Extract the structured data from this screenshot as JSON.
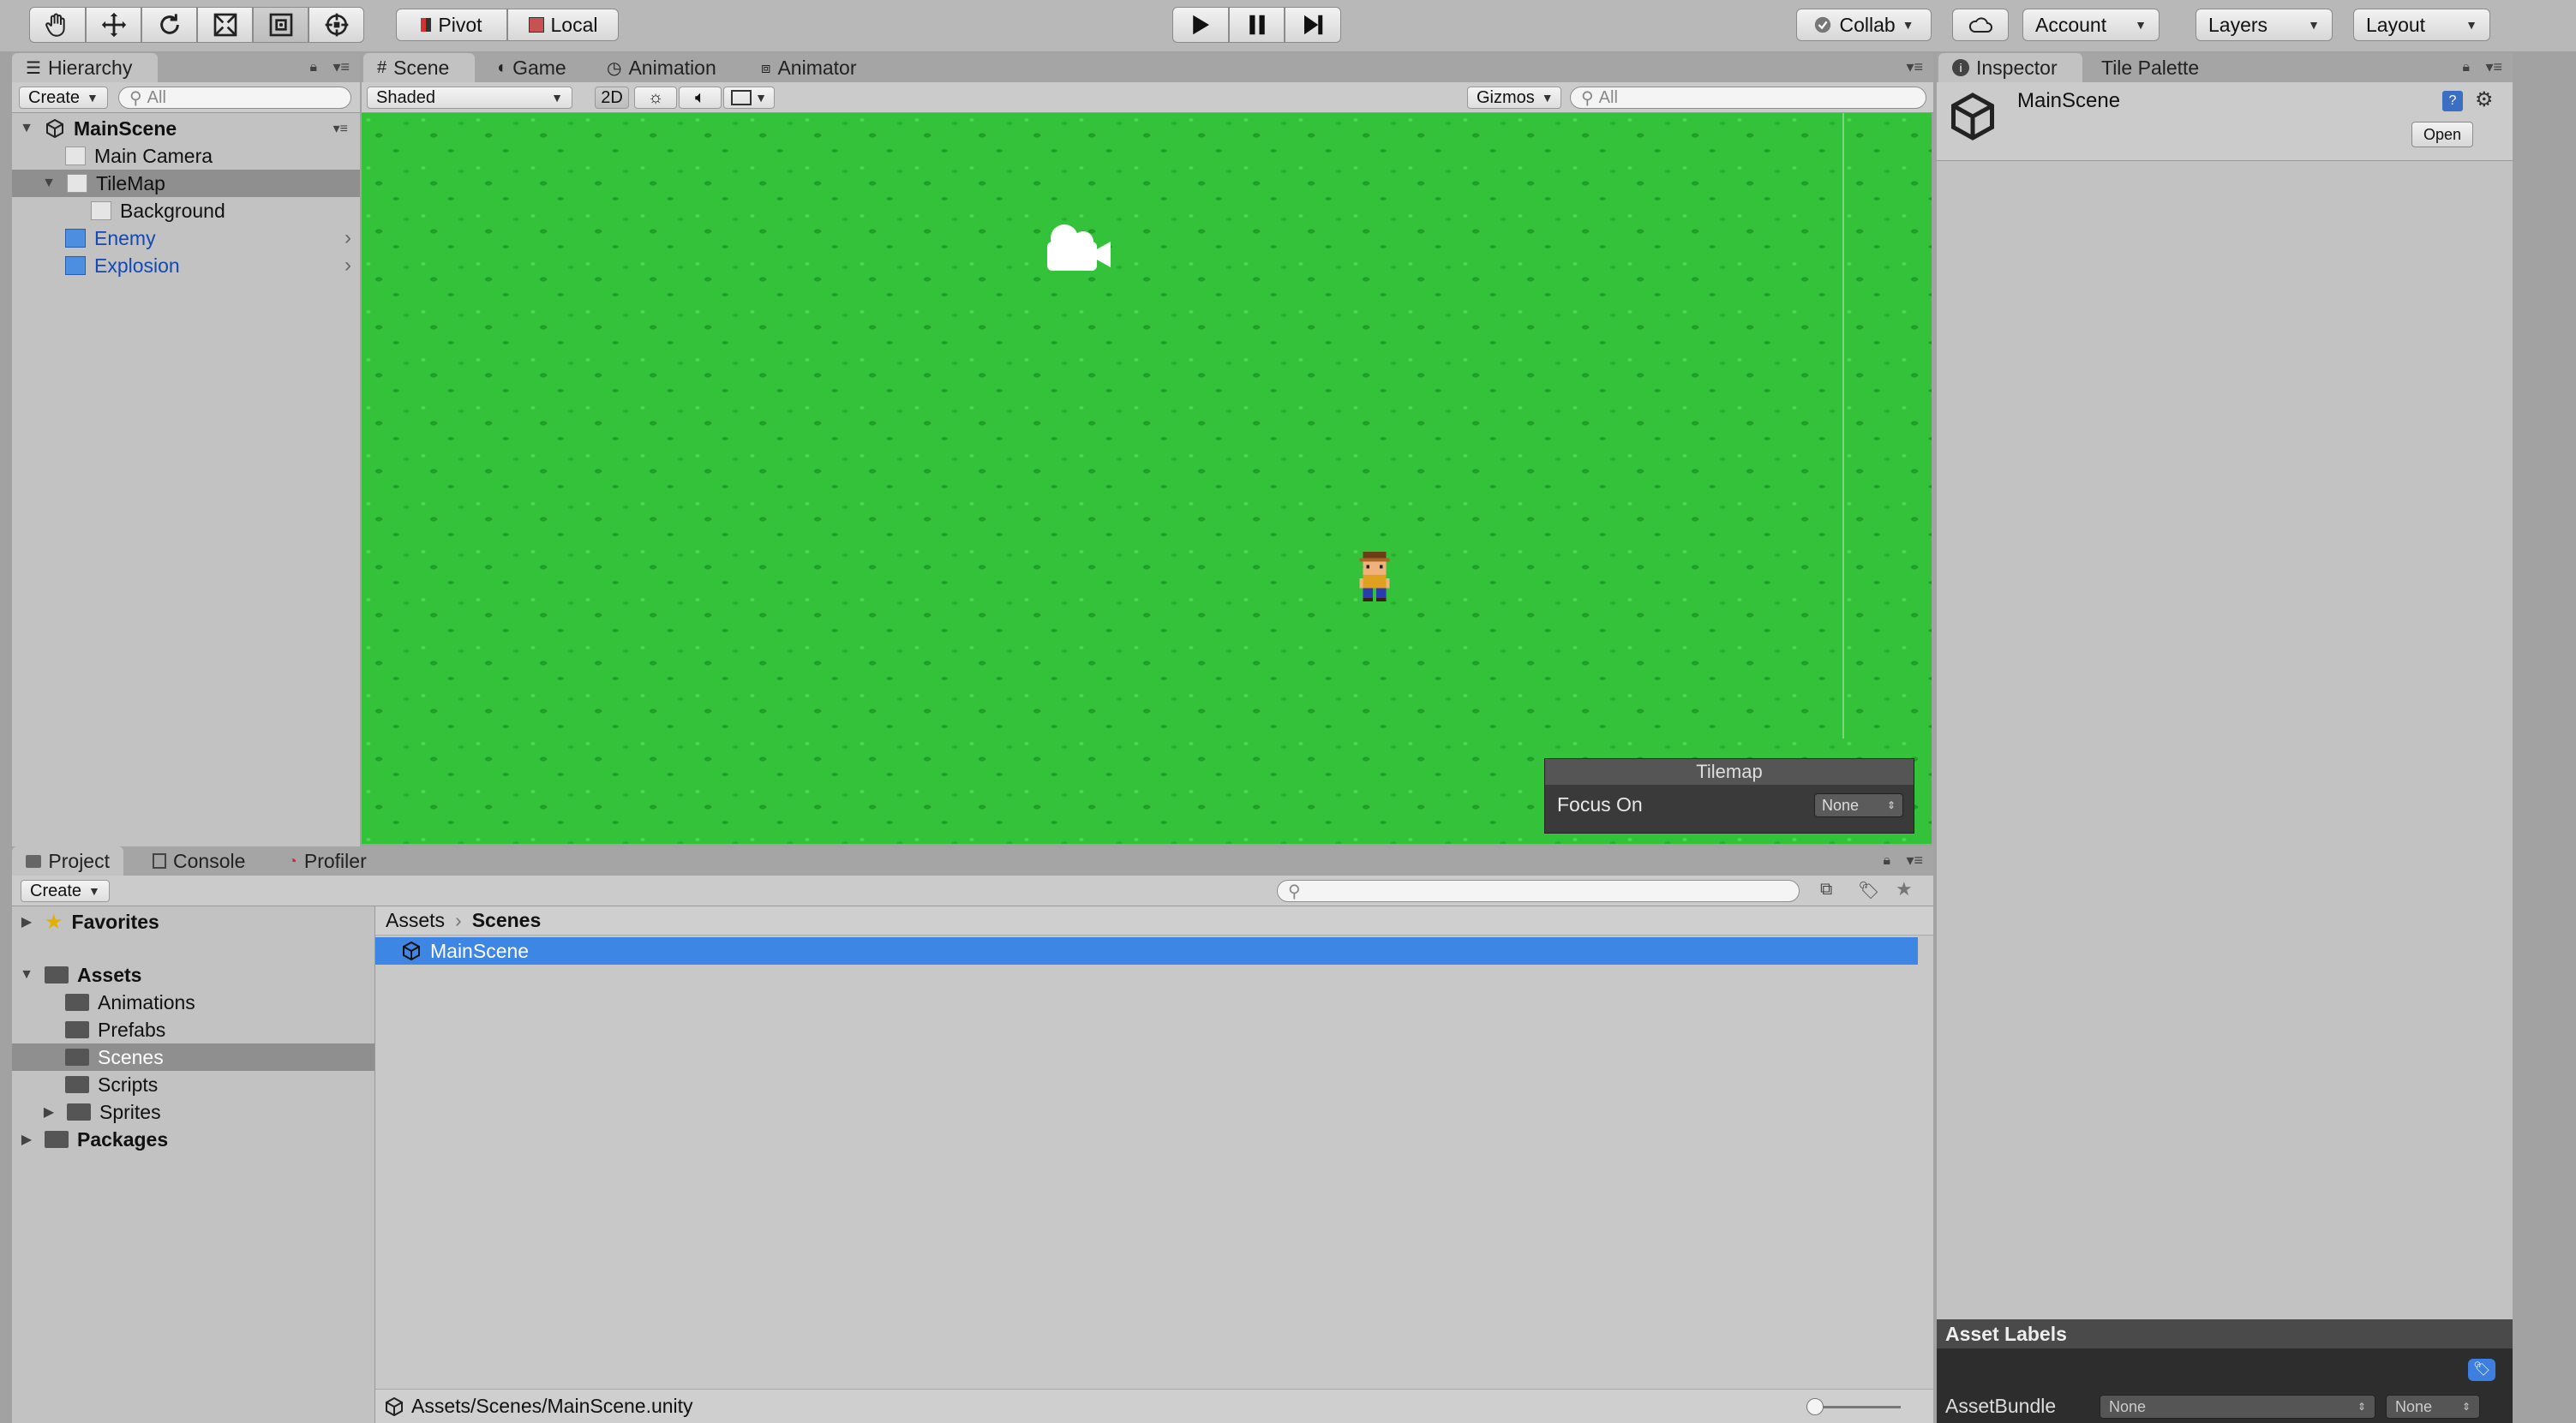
{
  "toolbar": {
    "pivot": "Pivot",
    "local": "Local",
    "collab": "Collab",
    "account": "Account",
    "layers": "Layers",
    "layout": "Layout"
  },
  "hierarchy": {
    "tab": "Hierarchy",
    "create": "Create",
    "search_placeholder": "All",
    "scene": "MainScene",
    "items": [
      {
        "label": "Main Camera"
      },
      {
        "label": "TileMap"
      },
      {
        "label": "Background"
      },
      {
        "label": "Enemy"
      },
      {
        "label": "Explosion"
      }
    ]
  },
  "scene_view": {
    "tabs": [
      "Scene",
      "Game",
      "Animation",
      "Animator"
    ],
    "shading": "Shaded",
    "mode_2d": "2D",
    "gizmos": "Gizmos",
    "search_placeholder": "All",
    "tilemap_overlay": {
      "title": "Tilemap",
      "focus_label": "Focus On",
      "focus_value": "None"
    }
  },
  "inspector": {
    "tabs": [
      "Inspector",
      "Tile Palette"
    ],
    "object_name": "MainScene",
    "open_button": "Open",
    "asset_labels": "Asset Labels",
    "asset_bundle_label": "AssetBundle",
    "asset_bundle_value": "None",
    "asset_bundle_variant": "None"
  },
  "project": {
    "tabs": [
      "Project",
      "Console",
      "Profiler"
    ],
    "create": "Create",
    "tree": {
      "favorites": "Favorites",
      "assets": "Assets",
      "folders": [
        "Animations",
        "Prefabs",
        "Scenes",
        "Scripts",
        "Sprites"
      ],
      "packages": "Packages"
    },
    "breadcrumb": [
      "Assets",
      "Scenes"
    ],
    "files": [
      {
        "name": "MainScene"
      }
    ],
    "status_path": "Assets/Scenes/MainScene.unity"
  },
  "colors": {
    "grass": "#33c23a",
    "selection": "#3d86e4",
    "prefab_text": "#1448b5"
  }
}
